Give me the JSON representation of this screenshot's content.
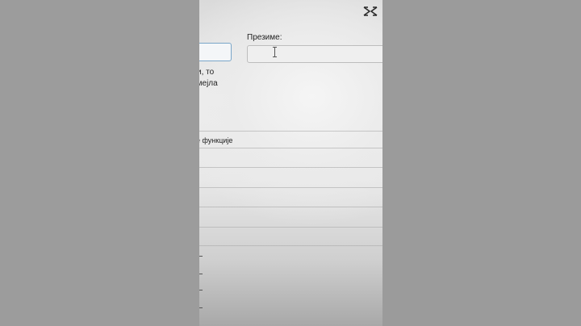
{
  "form": {
    "lastname_label": "Презиме:",
    "lastname_value": "",
    "firstname_value": "",
    "notice_line_1": "ази, то",
    "notice_line_2": "м мејла",
    "function_text": "ане функције"
  },
  "overlay": {
    "watermark_icon": "capcut-icon"
  },
  "icons": {
    "text_cursor": "text-cursor-icon"
  }
}
